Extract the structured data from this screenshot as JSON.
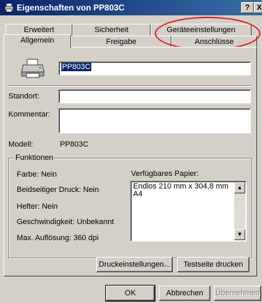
{
  "window": {
    "title": "Eigenschaften von PP803C",
    "help_glyph": "?",
    "close_glyph": "X",
    "icon": "printer-icon"
  },
  "tabs": {
    "row1": [
      "Erweitert",
      "Sicherheit",
      "Geräteeinstellungen"
    ],
    "row2": [
      "Allgemein",
      "Freigabe",
      "Anschlüsse"
    ],
    "active": "Allgemein"
  },
  "general": {
    "printer_icon": "printer-icon",
    "printer_name": "PP803C",
    "location_label": "Standort:",
    "location_value": "",
    "comment_label": "Kommentar:",
    "comment_value": "",
    "model_label": "Modell:",
    "model_value": "PP803C"
  },
  "features": {
    "group_label": "Funktionen",
    "color": "Farbe: Nein",
    "duplex": "Beidseitiger Druck: Nein",
    "staple": "Hefter: Nein",
    "speed": "Geschwindigkeit: Unbekannt",
    "resolution": "Max. Auflösung: 360 dpi",
    "paper_label": "Verfügbares Papier:",
    "paper_items": [
      "Endlos 210 mm x 304,8 mm",
      "A4"
    ]
  },
  "actions": {
    "print_prefs": "Druckeinstellungen...",
    "test_page": "Testseite drucken"
  },
  "footer": {
    "ok": "OK",
    "cancel": "Abbrechen",
    "apply": "Übernehmen"
  },
  "colors": {
    "title_bar": "#0a246a",
    "face": "#d4d0c8",
    "highlight": "#0a246a",
    "annotation": "#e02020"
  }
}
